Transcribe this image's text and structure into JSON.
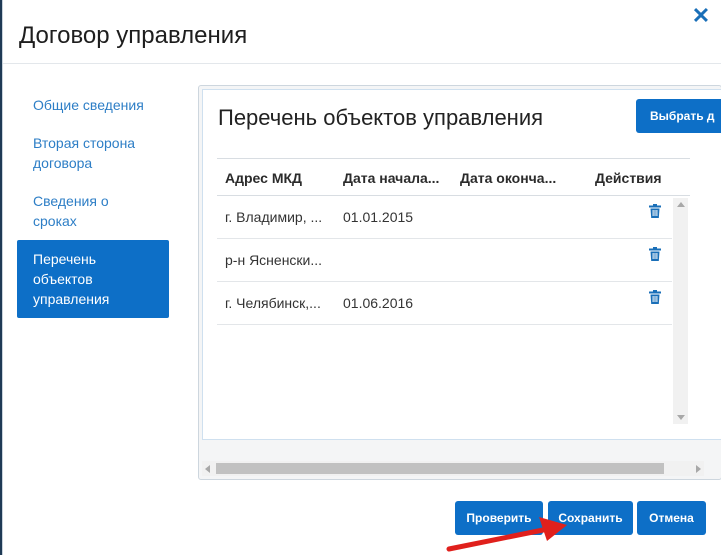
{
  "dialog": {
    "title": "Договор управления",
    "close_glyph": "✕"
  },
  "sidebar": {
    "items": [
      {
        "label": "Общие сведения",
        "active": false
      },
      {
        "label": "Вторая сторона договора",
        "active": false
      },
      {
        "label": "Сведения о сроках",
        "active": false
      },
      {
        "label": "Перечень объектов управления",
        "active": true
      }
    ]
  },
  "panel": {
    "title": "Перечень объектов управления",
    "select_button": "Выбрать д",
    "columns": [
      "Адрес МКД",
      "Дата начала...",
      "Дата оконча...",
      "Действия"
    ],
    "rows": [
      {
        "address": "г. Владимир, ...",
        "start": "01.01.2015",
        "end": "",
        "action_icon": "trash-icon"
      },
      {
        "address": "р-н Ясненски...",
        "start": "",
        "end": "",
        "action_icon": "trash-icon"
      },
      {
        "address": "г. Челябинск,...",
        "start": "01.06.2016",
        "end": "",
        "action_icon": "trash-icon"
      }
    ]
  },
  "footer": {
    "check_label": "Проверить",
    "save_label": "Сохранить",
    "cancel_label": "Отмена"
  },
  "colors": {
    "accent": "#0d6fc7",
    "link": "#2d7ec6",
    "annotation_arrow": "#e0201c"
  }
}
